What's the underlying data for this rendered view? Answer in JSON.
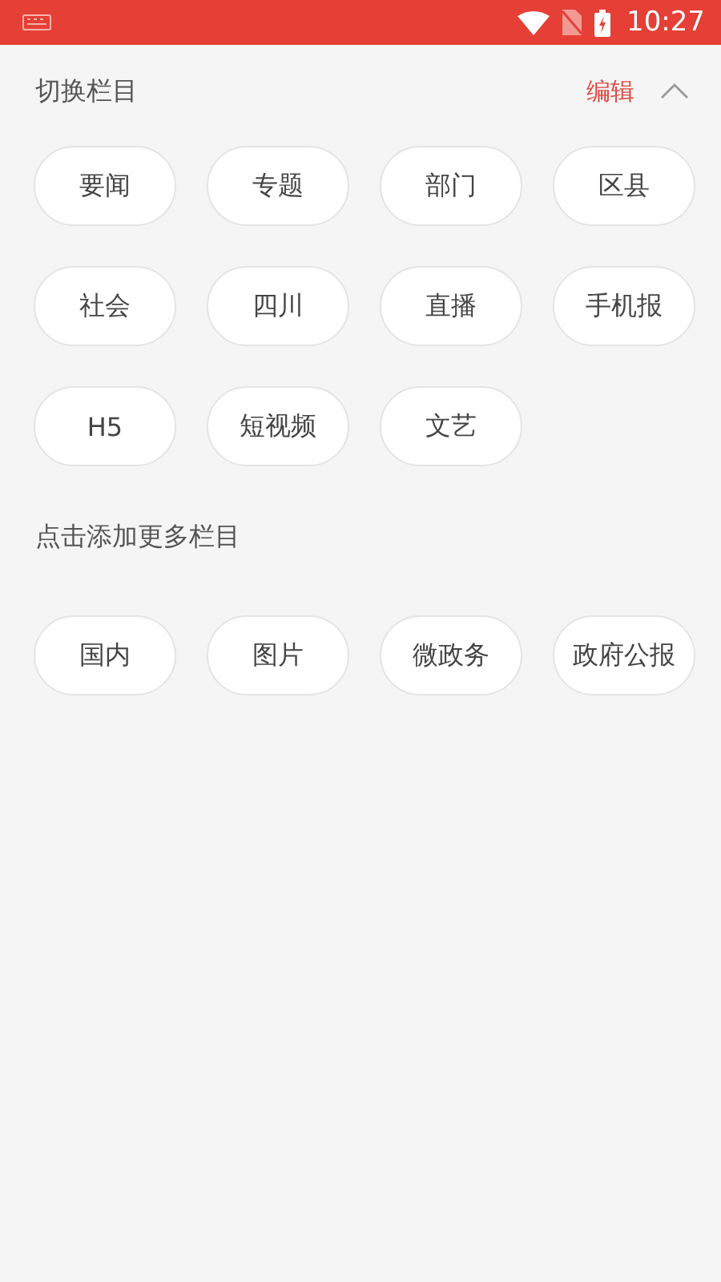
{
  "status_bar": {
    "time": "10:27"
  },
  "my_channels": {
    "title": "切换栏目",
    "edit_label": "编辑",
    "expanded": true,
    "items": [
      "要闻",
      "专题",
      "部门",
      "区县",
      "社会",
      "四川",
      "直播",
      "手机报",
      "H5",
      "短视频",
      "文艺"
    ]
  },
  "more_channels": {
    "title": "点击添加更多栏目",
    "items": [
      "国内",
      "图片",
      "微政务",
      "政府公报"
    ]
  }
}
